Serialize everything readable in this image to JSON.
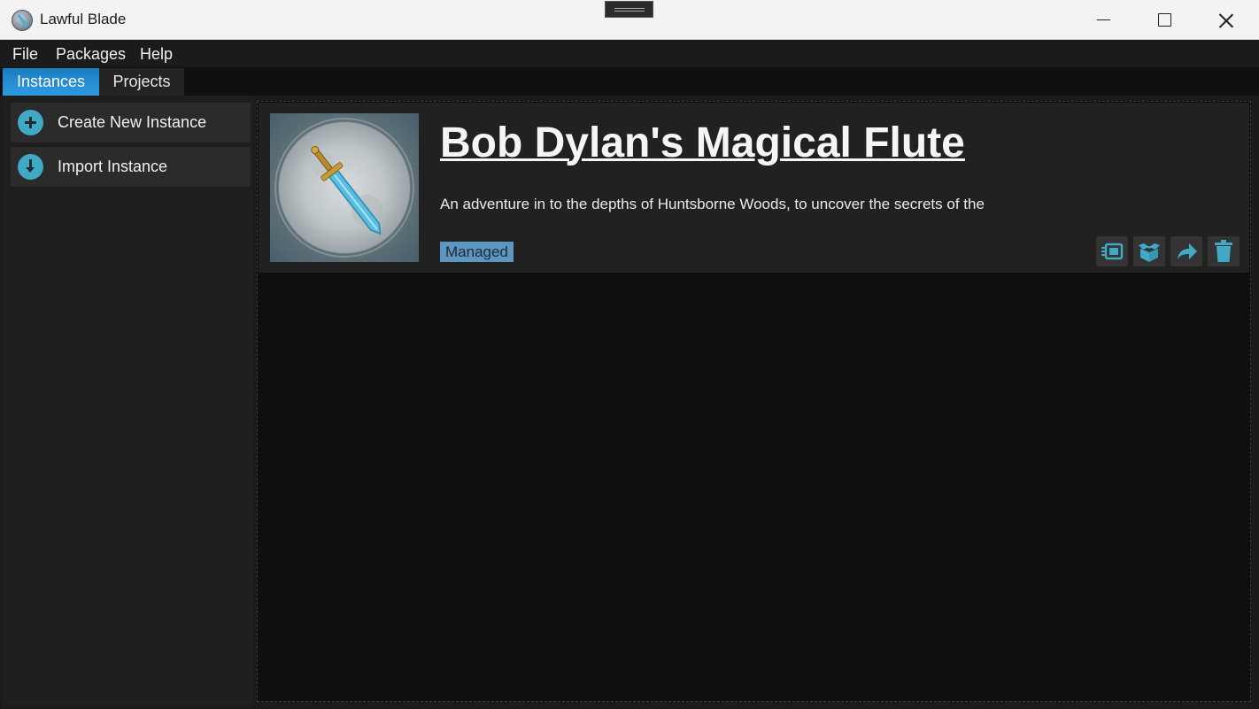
{
  "window": {
    "title": "Lawful Blade"
  },
  "menu": {
    "items": [
      "File",
      "Packages",
      "Help"
    ]
  },
  "tabs": [
    {
      "label": "Instances",
      "active": true
    },
    {
      "label": "Projects",
      "active": false
    }
  ],
  "sidebar": {
    "items": [
      {
        "label": "Create New Instance",
        "icon": "plus-circle-icon"
      },
      {
        "label": "Import Instance",
        "icon": "download-circle-icon"
      }
    ]
  },
  "instance": {
    "title": "Bob Dylan's Magical Flute",
    "description": "An adventure in to the depths of Huntsborne Woods, to uncover the secrets of the",
    "badge": "Managed",
    "actions": [
      "launch-icon",
      "package-icon",
      "share-icon",
      "trash-icon"
    ]
  },
  "colors": {
    "accent": "#41a9c4",
    "tab_active": "#2f9ae0",
    "badge": "#5d97bf"
  }
}
